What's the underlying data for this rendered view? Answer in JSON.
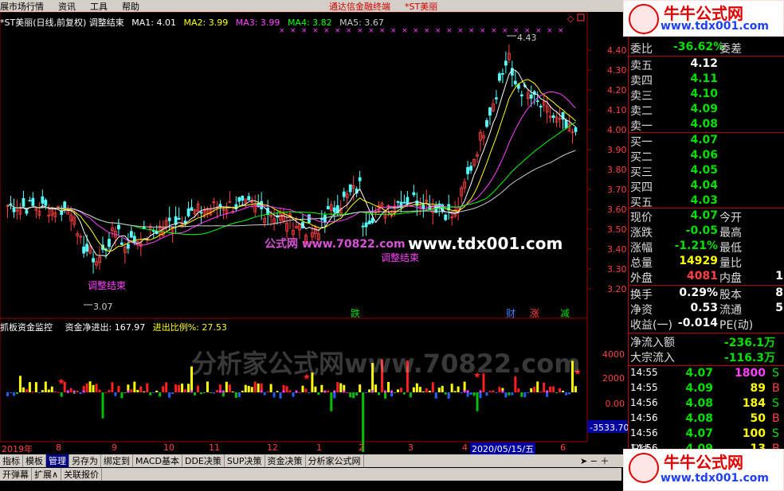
{
  "menubar": {
    "items": [
      "展市场行情",
      "资讯",
      "工具",
      "帮助"
    ],
    "center": "通达信金融终端",
    "stock": "*ST美丽"
  },
  "chart": {
    "title": "*ST美丽(日线,前复权) 调整结束",
    "ma": [
      {
        "label": "MA1: 4.01",
        "color": "#ffffff"
      },
      {
        "label": "MA2: 3.99",
        "color": "#ffff00"
      },
      {
        "label": "MA3: 3.99",
        "color": "#ff40ff"
      },
      {
        "label": "MA4: 3.82",
        "color": "#00ff00"
      },
      {
        "label": "MA5: 3.67",
        "color": "#cccccc"
      }
    ],
    "y_ticks": [
      "4.40",
      "4.30",
      "4.20",
      "4.10",
      "4.00",
      "3.90",
      "3.80",
      "3.70",
      "3.60",
      "3.50",
      "3.40",
      "3.30",
      "3.20"
    ],
    "high_label": "4.43",
    "low_label": "3.07",
    "signal_text": "调整结束",
    "events": [
      {
        "text": "跌",
        "color": "#00e000"
      },
      {
        "text": "财",
        "color": "#4080ff"
      },
      {
        "text": "涨",
        "color": "#ff4040"
      },
      {
        "text": "减",
        "color": "#00e000"
      }
    ]
  },
  "indicator": {
    "name": "抓板资金监控",
    "net_label": "资金净进出: 167.97",
    "ratio_label": "进出比例%: 27.53",
    "y_ticks": [
      "4000",
      "2000",
      "0.00"
    ],
    "min_label": "-3533.70"
  },
  "dates": {
    "year": "2019年",
    "months": [
      "8",
      "9",
      "10",
      "11",
      "12",
      "1",
      "2",
      "3",
      "4",
      "6"
    ],
    "cursor": "2020/05/15/五"
  },
  "panel": {
    "weibi": {
      "label": "委比",
      "value": "-36.62%",
      "label2": "委差"
    },
    "sell": [
      {
        "l": "卖五",
        "v": "4.12",
        "c": "#ffffff"
      },
      {
        "l": "卖四",
        "v": "4.11",
        "c": "#00e000"
      },
      {
        "l": "卖三",
        "v": "4.10",
        "c": "#00e000"
      },
      {
        "l": "卖二",
        "v": "4.09",
        "c": "#00e000"
      },
      {
        "l": "卖一",
        "v": "4.08",
        "c": "#00e000"
      }
    ],
    "buy": [
      {
        "l": "买一",
        "v": "4.07"
      },
      {
        "l": "买二",
        "v": "4.06"
      },
      {
        "l": "买三",
        "v": "4.05"
      },
      {
        "l": "买四",
        "v": "4.04"
      },
      {
        "l": "买五",
        "v": "4.03"
      }
    ],
    "quote": [
      {
        "l": "现价",
        "v": "4.07",
        "c": "#00e000",
        "l2": "今开",
        "v2": ""
      },
      {
        "l": "涨跌",
        "v": "-0.05",
        "c": "#00e000",
        "l2": "最高",
        "v2": ""
      },
      {
        "l": "涨幅",
        "v": "-1.21%",
        "c": "#00e000",
        "l2": "最低",
        "v2": ""
      },
      {
        "l": "总量",
        "v": "14929",
        "c": "#ffff00",
        "l2": "量比",
        "v2": ""
      },
      {
        "l": "外盘",
        "v": "4081",
        "c": "#ff4040",
        "l2": "内盘",
        "v2": "1"
      }
    ],
    "fin": [
      {
        "l": "换手",
        "v": "0.29%",
        "l2": "股本",
        "v2": "8"
      },
      {
        "l": "净资",
        "v": "0.53",
        "l2": "流通",
        "v2": "5"
      },
      {
        "l": "收益(一)",
        "v": "-0.014",
        "l2": "PE(动)",
        "v2": ""
      }
    ],
    "flow": [
      {
        "l": "净流入额",
        "v": "-236.1万"
      },
      {
        "l": "大宗流入",
        "v": "-116.3万"
      }
    ],
    "ticks": [
      {
        "t": "14:55",
        "p": "4.07",
        "v": "1800",
        "c": "#ff40ff",
        "s": "S"
      },
      {
        "t": "14:55",
        "p": "4.09",
        "v": "89",
        "c": "#ffff00",
        "s": "B"
      },
      {
        "t": "14:56",
        "p": "4.08",
        "v": "184",
        "c": "#ffff00",
        "s": "S"
      },
      {
        "t": "14:56",
        "p": "4.08",
        "v": "50",
        "c": "#ffff00",
        "s": "B"
      },
      {
        "t": "14:56",
        "p": "4.07",
        "v": "100",
        "c": "#ffff00",
        "s": "S"
      },
      {
        "t": "14:56",
        "p": "4.09",
        "v": "13",
        "c": "#ffff00",
        "s": "B"
      }
    ],
    "period": "日线"
  },
  "tabs1": [
    "指标",
    "模板",
    "管理",
    "另存为",
    "绑定到",
    "MACD基本",
    "DDE决策",
    "SUP决策",
    "资金决策",
    "分析家公式网"
  ],
  "tabs2": [
    "开弹幕",
    "扩展∧",
    "关联报价"
  ],
  "watermarks": {
    "w1": "分析家公式网www.70822.com",
    "w2": "www.tdx001.com",
    "w3": "公式网 www.70822.com"
  },
  "logo": {
    "title": "牛牛公式网",
    "url": "www.tdx001.com"
  }
}
